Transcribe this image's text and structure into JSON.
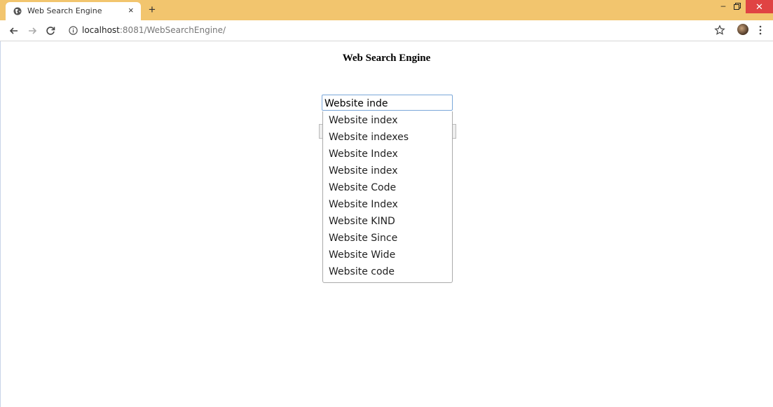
{
  "browser": {
    "tab": {
      "title": "Web Search Engine",
      "close": "×"
    },
    "new_tab": "+",
    "window": {
      "minimize": "–",
      "close": "✕"
    },
    "address": {
      "host": "localhost",
      "path": ":8081/WebSearchEngine/"
    }
  },
  "page": {
    "title": "Web Search Engine",
    "search": {
      "value": "Website inde"
    },
    "suggestions": [
      "Website index",
      "Website indexes",
      "Website Index",
      "Website index",
      "Website Code",
      "Website Index",
      "Website KIND",
      "Website Since",
      "Website Wide",
      "Website code"
    ]
  },
  "colors": {
    "tabstrip": "#f2c56e",
    "window_close": "#e04343",
    "input_border": "#7aa7d9"
  }
}
